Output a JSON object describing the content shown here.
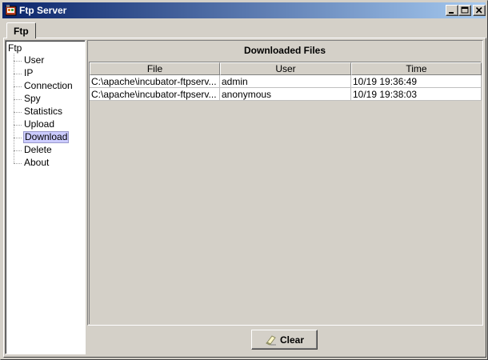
{
  "window": {
    "title": "Ftp Server",
    "controls": {
      "minimize_icon": "minimize-icon",
      "maximize_icon": "maximize-icon",
      "close_icon": "close-icon"
    }
  },
  "tabs": [
    {
      "label": "Ftp",
      "selected": true
    }
  ],
  "tree": {
    "root": "Ftp",
    "items": [
      {
        "label": "User"
      },
      {
        "label": "IP"
      },
      {
        "label": "Connection"
      },
      {
        "label": "Spy"
      },
      {
        "label": "Statistics"
      },
      {
        "label": "Upload"
      },
      {
        "label": "Download",
        "selected": true
      },
      {
        "label": "Delete"
      },
      {
        "label": "About"
      }
    ]
  },
  "panel": {
    "heading": "Downloaded Files",
    "columns": [
      "File",
      "User",
      "Time"
    ],
    "rows": [
      {
        "file": "C:\\apache\\incubator-ftpserv...",
        "user": "admin",
        "time": "10/19 19:36:49"
      },
      {
        "file": "C:\\apache\\incubator-ftpserv...",
        "user": "anonymous",
        "time": "10/19 19:38:03"
      }
    ]
  },
  "footer": {
    "clear_label": "Clear",
    "clear_icon": "eraser-icon"
  },
  "colors": {
    "title_start": "#0a246a",
    "title_end": "#a6caf0",
    "selection": "#ccccff",
    "background": "#d4d0c8"
  }
}
